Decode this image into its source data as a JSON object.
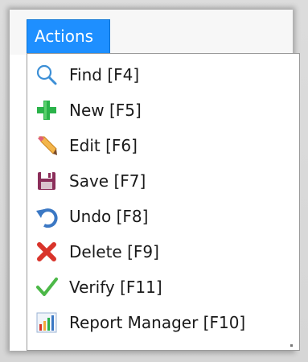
{
  "menu": {
    "title": "Actions",
    "items": [
      {
        "label": "Find [F4]",
        "icon": "search-icon"
      },
      {
        "label": "New [F5]",
        "icon": "plus-icon"
      },
      {
        "label": "Edit [F6]",
        "icon": "pencil-icon"
      },
      {
        "label": "Save [F7]",
        "icon": "save-icon"
      },
      {
        "label": "Undo [F8]",
        "icon": "undo-icon"
      },
      {
        "label": "Delete [F9]",
        "icon": "delete-icon"
      },
      {
        "label": "Verify [F11]",
        "icon": "check-icon"
      },
      {
        "label": "Report Manager [F10]",
        "icon": "report-icon"
      }
    ]
  },
  "colors": {
    "accent": "#1e8fff",
    "add_green": "#2bb34a",
    "delete_red": "#d9342b",
    "save_magenta": "#8b2e5a",
    "undo_blue": "#3b78c4",
    "verify_green": "#4cb848"
  }
}
